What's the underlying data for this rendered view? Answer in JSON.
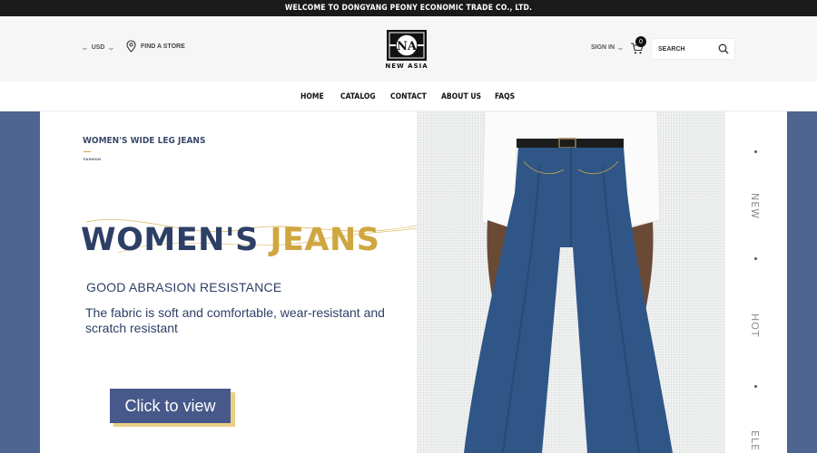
{
  "announcement": "WELCOME TO DONGYANG PEONY ECONOMIC TRADE CO., LTD.",
  "header": {
    "currency": "USD",
    "find_store": "FIND A STORE",
    "logo_text": "NEW ASIA",
    "logo_monogram": "NA",
    "sign_in": "SIGN IN",
    "cart_count": "0",
    "search_placeholder": "SEARCH"
  },
  "nav": {
    "items": [
      "HOME",
      "CATALOG",
      "CONTACT",
      "ABOUT US",
      "FAQS"
    ]
  },
  "hero": {
    "small_title": "WOMEN'S WIDE LEG JEANS",
    "small_subtitle": "FASHION",
    "big_title_part1": "WOMEN'S",
    "big_title_part2": "JEANS",
    "feature": "GOOD ABRASION RESISTANCE",
    "description": "The fabric is soft and comfortable, wear-resistant and scratch resistant",
    "cta": "Click to view",
    "side_labels": [
      "NEW",
      "HOT",
      "ELE"
    ]
  },
  "colors": {
    "brand_navy": "#47598a",
    "accent_gold": "#cfa640",
    "announcement_bg": "#1a1a1a",
    "denim": "#2f5687"
  },
  "icons": [
    "chevron-down-icon",
    "location-pin-icon",
    "cart-icon",
    "search-icon",
    "logo-icon"
  ]
}
